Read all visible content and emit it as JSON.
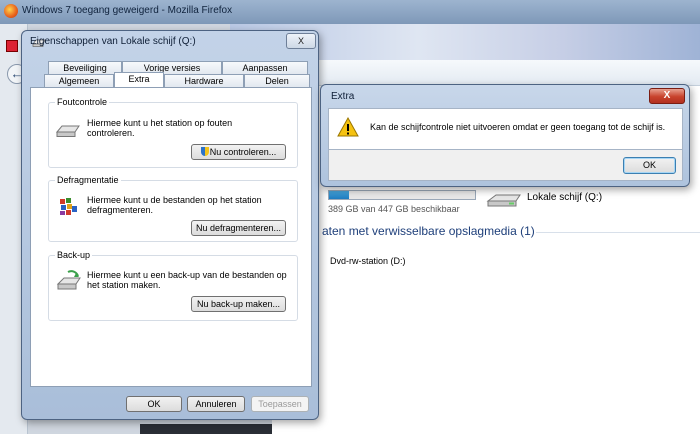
{
  "firefox": {
    "title": "Windows 7 toegang geweigerd - Mozilla Firefox"
  },
  "explorer": {
    "drive_free": "389 GB van 447 GB beschikbaar",
    "drive_q_label": "Lokale schijf (Q:)",
    "removable_header": "aten met verwisselbare opslagmedia (1)",
    "dvd_label": "Dvd-rw-station (D:)"
  },
  "properties": {
    "title": "Eigenschappen van Lokale schijf (Q:)",
    "close_label": "X",
    "tabs_row1": [
      "Beveiliging",
      "Vorige versies",
      "Aanpassen"
    ],
    "tabs_row2": [
      "Algemeen",
      "Extra",
      "Hardware",
      "Delen"
    ],
    "active_tab": "Extra",
    "groups": {
      "errorcheck": {
        "title": "Foutcontrole",
        "text1": "Hiermee kunt u het station op fouten",
        "text2": "controleren.",
        "button": "Nu controleren..."
      },
      "defrag": {
        "title": "Defragmentatie",
        "text1": "Hiermee kunt u de bestanden op het station",
        "text2": "defragmenteren.",
        "button": "Nu defragmenteren..."
      },
      "backup": {
        "title": "Back-up",
        "text1": "Hiermee kunt u een back-up van de bestanden op",
        "text2": "het station maken.",
        "button": "Nu back-up maken..."
      }
    },
    "footer": {
      "ok": "OK",
      "cancel": "Annuleren",
      "apply": "Toepassen"
    }
  },
  "error_dialog": {
    "title": "Extra",
    "message": "Kan de schijfcontrole niet uitvoeren omdat er geen toegang tot de schijf is.",
    "ok": "OK",
    "close_label": "X"
  },
  "colors": {
    "warning_icon": "#f5c211",
    "close_red": "#c8422c",
    "accent_blue": "#1e3f7a"
  }
}
